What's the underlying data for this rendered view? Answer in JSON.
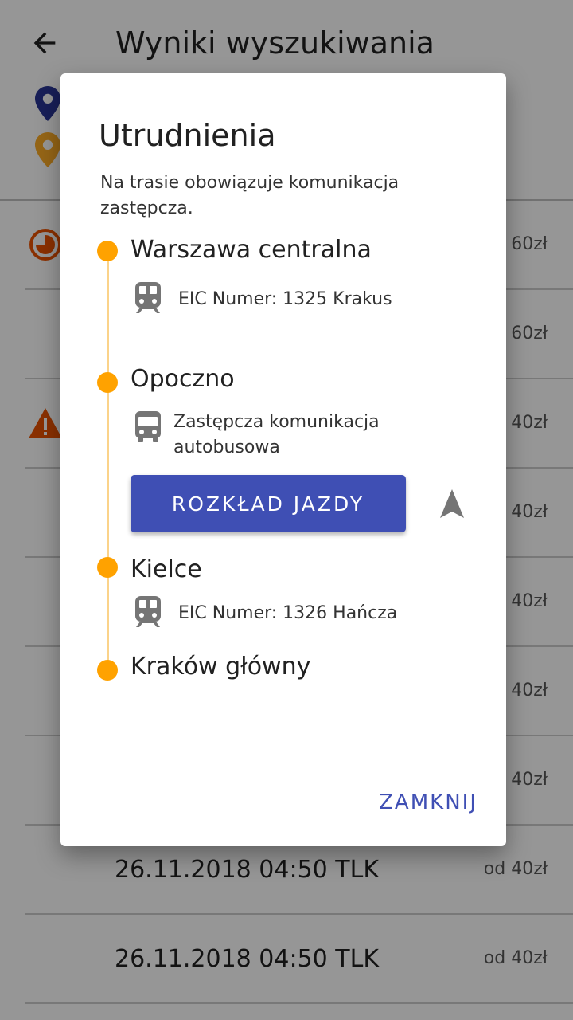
{
  "header": {
    "title": "Wyniki wyszukiwania"
  },
  "results": [
    {
      "text": "",
      "price": "60zł",
      "status": "clock-icon"
    },
    {
      "text": "",
      "price": "60zł",
      "status": ""
    },
    {
      "text": "",
      "price": "40zł",
      "status": "warning-icon"
    },
    {
      "text": "",
      "price": "40zł",
      "status": ""
    },
    {
      "text": "",
      "price": "40zł",
      "status": ""
    },
    {
      "text": "",
      "price": "40zł",
      "status": ""
    },
    {
      "text": "",
      "price": "40zł",
      "status": ""
    },
    {
      "text": "26.11.2018 04:50 TLK",
      "price": "od 40zł",
      "status": ""
    },
    {
      "text": "26.11.2018 04:50 TLK",
      "price": "od 40zł",
      "status": ""
    }
  ],
  "dialog": {
    "title": "Utrudnienia",
    "message": "Na trasie obowiązuje komunikacja zastępcza.",
    "stops": [
      {
        "name": "Warszawa centralna"
      },
      {
        "name": "Opoczno"
      },
      {
        "name": "Kielce"
      },
      {
        "name": "Kraków główny"
      }
    ],
    "legs": [
      {
        "icon": "train-icon",
        "text": "EIC Numer: 1325 Krakus"
      },
      {
        "icon": "bus-icon",
        "text_line1": "Zastępcza komunikacja",
        "text_line2": "autobusowa"
      },
      {
        "icon": "train-icon",
        "text": "EIC Numer: 1326 Hańcza"
      }
    ],
    "schedule_button": "ROZKŁAD JAZDY",
    "close_button": "ZAMKNIJ"
  },
  "colors": {
    "accent": "#3f4fb4",
    "timeline": "#ffa200",
    "warning": "#e65100",
    "pin_from": "#283593",
    "pin_to": "#f9a825"
  }
}
